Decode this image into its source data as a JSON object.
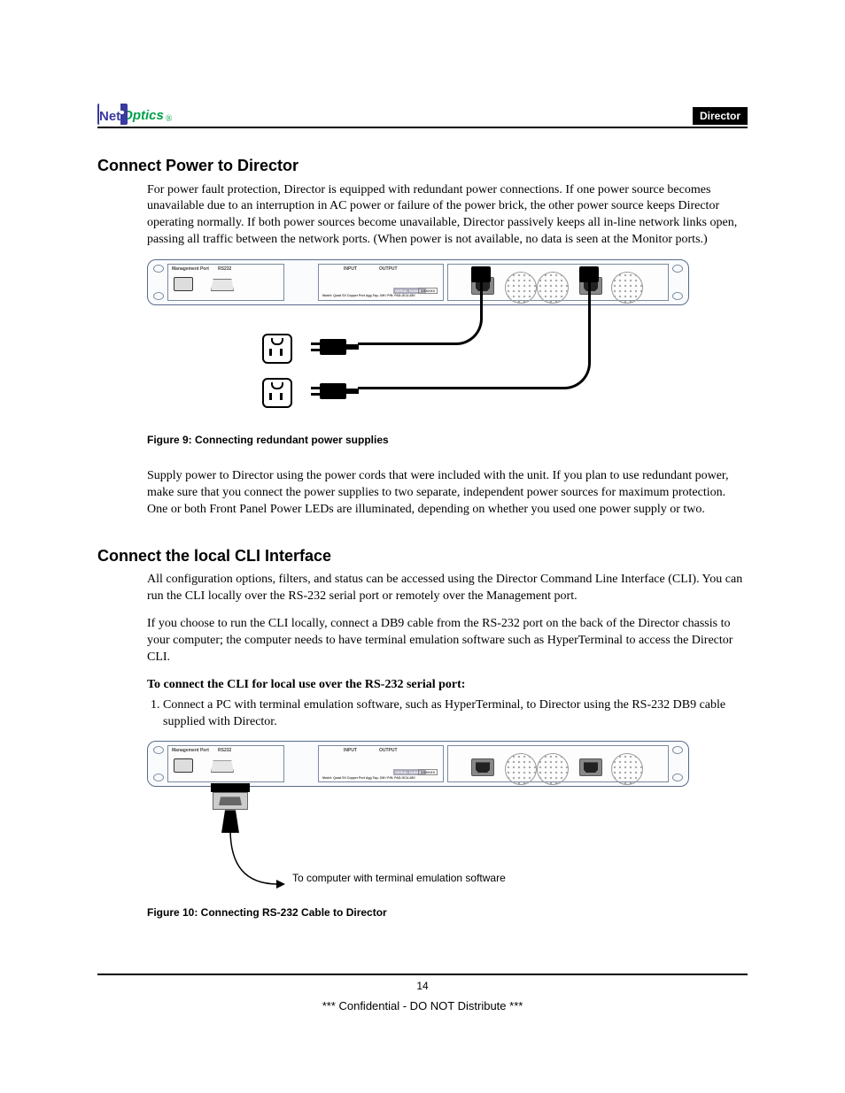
{
  "header": {
    "logo_net": "Net",
    "logo_optics": "Optics",
    "logo_reg": "®",
    "badge": "Director"
  },
  "section1": {
    "heading": "Connect Power to Director",
    "para1": "For power fault protection, Director is equipped with redundant power connections. If one power source becomes unavailable due to an interruption in AC power or failure of the power brick, the other power source keeps Director operating normally. If both power sources become unavailable, Director passively keeps all in-line network links open, passing all traffic between the network ports. (When power is not available, no data is seen at the Monitor ports.)",
    "fig9": {
      "labels": {
        "mgmt": "Management Port",
        "rs232": "RS232",
        "input": "INPUT",
        "output": "OUTPUT",
        "serial": "SERIAL NUMBER",
        "serial_value": "XXXXXX",
        "model_line": "Model: Quad SX Copper Port Agg Tap- OM / P/N: PAD-GCU-48V"
      },
      "caption": "Figure 9: Connecting redundant power supplies"
    },
    "para2": "Supply power to Director using the power cords that were included with the unit. If you plan to use redundant power, make sure that you connect the power supplies to two separate, independent power sources for maximum protection. One or both Front Panel Power LEDs are illuminated, depending on whether you used one power supply or two."
  },
  "section2": {
    "heading": "Connect the local CLI Interface",
    "para1": "All configuration options, filters, and status can be accessed using the Director Command Line Interface (CLI). You can run the CLI locally over the RS-232 serial port or remotely over the Management port.",
    "para2": "If you choose to run the CLI locally, connect a DB9 cable from the RS-232 port on the back of the Director chassis to your computer; the computer needs to have terminal emulation software such as HyperTerminal to access the Director CLI.",
    "instruction_heading": "To connect the CLI for local use over the RS-232 serial port:",
    "step1": "Connect a PC with terminal emulation software, such as HyperTerminal, to Director using the RS-232 DB9 cable supplied with Director.",
    "fig10": {
      "labels": {
        "mgmt": "Management Port",
        "rs232": "RS232",
        "input": "INPUT",
        "output": "OUTPUT",
        "serial": "SERIAL NUMBER",
        "serial_value": "XXXXXX",
        "model_line": "Model: Quad SX Copper Port Agg Tap- OM / P/N: PAD-GCU-48V"
      },
      "caption": "Figure 10: Connecting RS-232 Cable to Director",
      "terminal_label": "To computer with terminal emulation software"
    }
  },
  "footer": {
    "page_number": "14",
    "confidential": "*** Confidential - DO NOT Distribute ***"
  }
}
